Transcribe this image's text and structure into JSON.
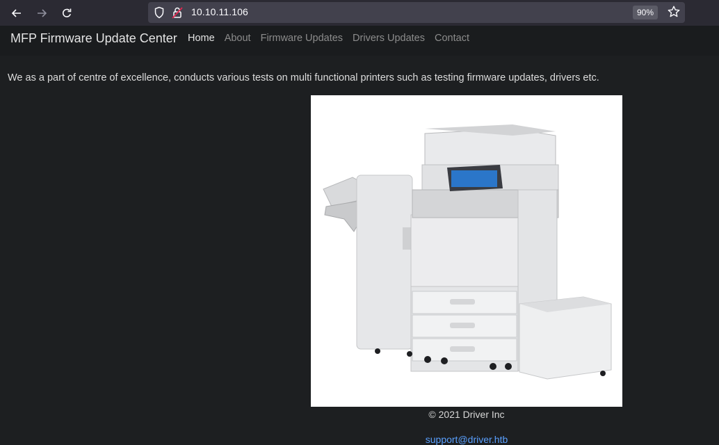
{
  "browser": {
    "url": "10.10.11.106",
    "zoom": "90%",
    "icons": [
      "back-arrow-icon",
      "forward-arrow-icon",
      "reload-icon",
      "shield-icon",
      "insecure-lock-icon",
      "bookmark-star-icon"
    ]
  },
  "navbar": {
    "brand": "MFP Firmware Update Center",
    "links": [
      {
        "label": "Home",
        "active": true
      },
      {
        "label": "About",
        "active": false
      },
      {
        "label": "Firmware Updates",
        "active": false
      },
      {
        "label": "Drivers Updates",
        "active": false
      },
      {
        "label": "Contact",
        "active": false
      }
    ]
  },
  "main": {
    "intro": "We as a part of centre of excellence, conducts various tests on multi functional printers such as testing firmware updates, drivers etc."
  },
  "footer": {
    "copyright": "© 2021 Driver Inc",
    "email": "support@driver.htb"
  }
}
